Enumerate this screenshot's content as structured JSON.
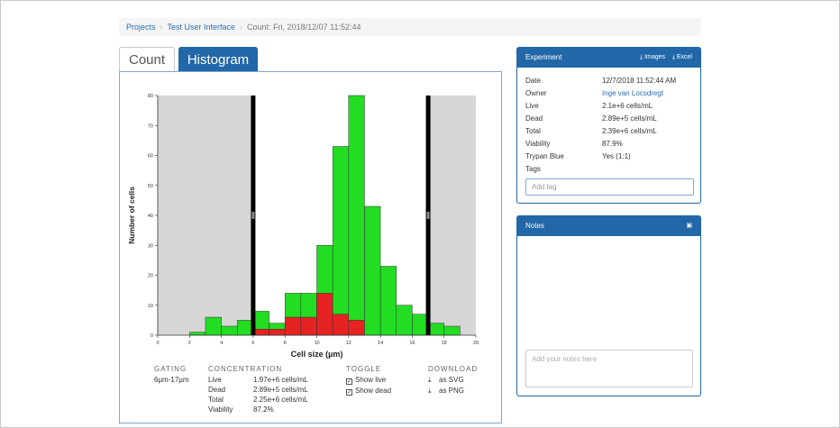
{
  "breadcrumb": {
    "items": [
      "Projects",
      "Test User Interface",
      "Count: Fri, 2018/12/07 11:52:44"
    ]
  },
  "tabs": [
    {
      "label": "Count"
    },
    {
      "label": "Histogram"
    }
  ],
  "chart_data": {
    "type": "bar",
    "xlabel": "Cell size (µm)",
    "ylabel": "Number of cells",
    "xlim": [
      0,
      20
    ],
    "ylim": [
      0,
      80
    ],
    "xticks": [
      "0",
      "2",
      "4",
      "6",
      "8",
      "10",
      "12",
      "14",
      "16",
      "18",
      "20"
    ],
    "yticks": [
      "0",
      "10",
      "20",
      "30",
      "40",
      "50",
      "60",
      "70",
      "80"
    ],
    "bin_width": 1,
    "bins": [
      2,
      3,
      4,
      5,
      6,
      7,
      8,
      9,
      10,
      11,
      12,
      13,
      14,
      15,
      16,
      17,
      18
    ],
    "series": [
      {
        "name": "Show live",
        "color": "#22dd22",
        "values": [
          1,
          6,
          3,
          5,
          8,
          4,
          14,
          14,
          30,
          63,
          80,
          43,
          23,
          10,
          7,
          4,
          3
        ]
      },
      {
        "name": "Show dead",
        "color": "#e62222",
        "values": [
          0,
          0,
          0,
          0,
          2,
          2,
          6,
          6,
          14,
          7,
          5,
          0,
          0,
          0,
          0,
          0,
          0
        ]
      }
    ],
    "gate": [
      6,
      17
    ],
    "gate_color": "#000000",
    "outside_gate_color": "#d6d6d6"
  },
  "stats": {
    "gating": {
      "heading": "GATING",
      "value": "6µm-17µm"
    },
    "concentration": {
      "heading": "CONCENTRATION",
      "rows": [
        {
          "k": "Live",
          "v": "1.97e+6 cells/mL"
        },
        {
          "k": "Dead",
          "v": "2.89e+5 cells/mL"
        },
        {
          "k": "Total",
          "v": "2.25e+6 cells/mL"
        },
        {
          "k": "Viability",
          "v": "87.2%"
        }
      ]
    },
    "toggle": {
      "heading": "TOGGLE",
      "items": [
        "Show live",
        "Show dead"
      ]
    },
    "download": {
      "heading": "DOWNLOAD",
      "items": [
        "as SVG",
        "as PNG"
      ]
    }
  },
  "experiment": {
    "title": "Experiment",
    "images_label": "Images",
    "excel_label": "Excel",
    "rows": [
      {
        "k": "Date",
        "v": "12/7/2018 11:52:44 AM"
      },
      {
        "k": "Owner",
        "v": "Inge van Locsdregt"
      },
      {
        "k": "Live",
        "v": "2.1e+6 cells/mL"
      },
      {
        "k": "Dead",
        "v": "2.89e+5 cells/mL"
      },
      {
        "k": "Total",
        "v": "2.39e+6 cells/mL"
      },
      {
        "k": "Viability",
        "v": "87.9%"
      },
      {
        "k": "Trypan Blue",
        "v": "Yes (1:1)"
      },
      {
        "k": "Tags",
        "v": ""
      }
    ],
    "tag_placeholder": "Add tag"
  },
  "notes": {
    "title": "Notes",
    "placeholder": "Add your notes here"
  },
  "colors": {
    "accent": "#2267a8",
    "link": "#2a6eaf"
  }
}
